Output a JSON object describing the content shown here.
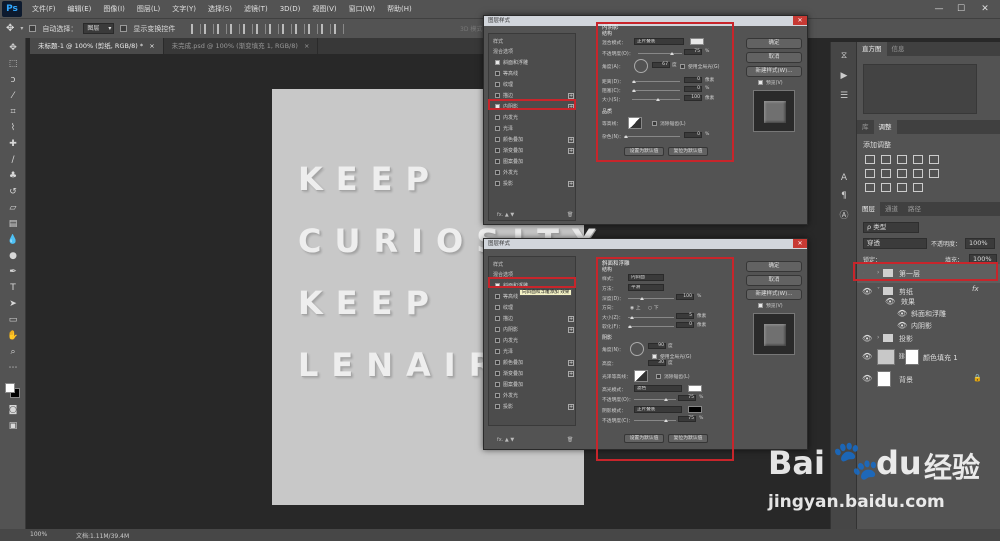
{
  "app": {
    "logo": "Ps"
  },
  "menubar": [
    "文件(F)",
    "编辑(E)",
    "图像(I)",
    "图层(L)",
    "文字(Y)",
    "选择(S)",
    "滤镜(T)",
    "3D(D)",
    "视图(V)",
    "窗口(W)",
    "帮助(H)"
  ],
  "window_controls": [
    "—",
    "☐",
    "✕"
  ],
  "options": {
    "auto_select_label": "自动选择：",
    "auto_select_value": "图层",
    "show_transform_label": "显示变换控件",
    "mode_3d_label": "3D 模式："
  },
  "doc_tabs": [
    {
      "label": "未标题-1 @ 100% (剪纸, RGB/8) *",
      "close": "×"
    },
    {
      "label": "未完成.psd @ 100% (渐变填充 1, RGB/8)",
      "close": "×"
    }
  ],
  "canvas": {
    "lines": [
      "KEEP",
      "CURIOSITY",
      "KEEP",
      "LENAIRNG"
    ],
    "bg": "#c8c8c8"
  },
  "status": {
    "zoom": "100%",
    "doc": "文档:1.11M/39.4M"
  },
  "panels": {
    "top_tabs": [
      "直方图",
      "信息"
    ],
    "adj_tabs": [
      "库",
      "调整"
    ],
    "adj_title": "添加调整",
    "layer_tabs": [
      "图层",
      "通道",
      "路径"
    ],
    "kind_label": "ρ 类型",
    "blend": "穿透",
    "opacity_label": "不透明度：",
    "opacity": "100%",
    "lock_label": "锁定：",
    "fill_label": "填充：",
    "fill": "100%",
    "layers": [
      {
        "name": "第一层",
        "type": "group",
        "fx": ""
      },
      {
        "name": "剪纸",
        "type": "group",
        "fx": "fx"
      },
      {
        "name": "效果",
        "type": "effect-head",
        "fx": ""
      },
      {
        "name": "斜面和浮雕",
        "type": "effect",
        "fx": ""
      },
      {
        "name": "内阴影",
        "type": "effect",
        "fx": ""
      },
      {
        "name": "投影",
        "type": "group",
        "fx": ""
      },
      {
        "name": "颜色填充 1",
        "type": "fill",
        "fx": ""
      },
      {
        "name": "背景",
        "type": "background",
        "fx": ""
      }
    ]
  },
  "dialog1": {
    "title": "图层样式",
    "list_header": "样式",
    "list_sub": "混合选项",
    "items": [
      {
        "label": "斜面和浮雕",
        "checked": true,
        "plus": false
      },
      {
        "label": "等高线",
        "checked": false,
        "plus": false
      },
      {
        "label": "纹理",
        "checked": false,
        "plus": false
      },
      {
        "label": "描边",
        "checked": false,
        "plus": true
      },
      {
        "label": "内阴影",
        "checked": true,
        "plus": true
      },
      {
        "label": "内发光",
        "checked": false,
        "plus": false
      },
      {
        "label": "光泽",
        "checked": false,
        "plus": false
      },
      {
        "label": "颜色叠加",
        "checked": false,
        "plus": true
      },
      {
        "label": "渐变叠加",
        "checked": false,
        "plus": true
      },
      {
        "label": "图案叠加",
        "checked": false,
        "plus": false
      },
      {
        "label": "外发光",
        "checked": false,
        "plus": false
      },
      {
        "label": "投影",
        "checked": false,
        "plus": true
      }
    ],
    "section_title": "内阴影",
    "struct_label": "结构",
    "blend_label": "混合模式：",
    "blend_value": "正片叠底",
    "opacity_label": "不透明度(O)：",
    "opacity_value": "75",
    "angle_label": "角度(A)：",
    "angle_value": "67",
    "global_light_label": "使用全局光(G)",
    "distance_label": "距离(D)：",
    "distance_value": "0",
    "choke_label": "阻塞(C)：",
    "choke_value": "0",
    "size_label": "大小(S)：",
    "size_value": "100",
    "quality_label": "品质",
    "contour_label": "等高线：",
    "antialias_label": "消除锯齿(L)",
    "noise_label": "杂色(N)：",
    "noise_value": "0",
    "btn_default": "设置为默认值",
    "btn_reset": "复位为默认值",
    "ok_label": "确定",
    "cancel_label": "取消",
    "new_style_label": "新建样式(W)...",
    "preview_label": "预览(V)"
  },
  "dialog2": {
    "title": "图层样式",
    "list_header": "样式",
    "list_sub": "混合选项",
    "tooltip": "向斜面和浮雕添加 效果",
    "items": [
      {
        "label": "斜面和浮雕",
        "checked": true,
        "plus": false
      },
      {
        "label": "等高线",
        "checked": false,
        "plus": false
      },
      {
        "label": "纹理",
        "checked": false,
        "plus": false
      },
      {
        "label": "描边",
        "checked": false,
        "plus": true
      },
      {
        "label": "内阴影",
        "checked": false,
        "plus": true
      },
      {
        "label": "内发光",
        "checked": false,
        "plus": false
      },
      {
        "label": "光泽",
        "checked": false,
        "plus": false
      },
      {
        "label": "颜色叠加",
        "checked": false,
        "plus": true
      },
      {
        "label": "渐变叠加",
        "checked": false,
        "plus": true
      },
      {
        "label": "图案叠加",
        "checked": false,
        "plus": false
      },
      {
        "label": "外发光",
        "checked": false,
        "plus": false
      },
      {
        "label": "投影",
        "checked": false,
        "plus": true
      }
    ],
    "section_title": "斜面和浮雕",
    "struct_label": "结构",
    "style_label": "样式：",
    "style_value": "内斜面",
    "method_label": "方法：",
    "method_value": "平滑",
    "depth_label": "深度(D)：",
    "depth_value": "100",
    "direction_label": "方向：",
    "dir_up": "上",
    "dir_down": "下",
    "size_label": "大小(Z)：",
    "size_value": "5",
    "soften_label": "软化(F)：",
    "soften_value": "0",
    "shading_label": "阴影",
    "angle_label": "角度(N)：",
    "angle_value": "90",
    "global_light_label": "使用全局光(G)",
    "altitude_label": "高度：",
    "altitude_value": "30",
    "gloss_label": "光泽等高线：",
    "antialias_label": "消除锯齿(L)",
    "highlight_label": "高光模式：",
    "highlight_value": "滤色",
    "hl_opacity_label": "不透明度(O)：",
    "hl_opacity_value": "75",
    "shadow_label": "阴影模式：",
    "shadow_value": "正片叠底",
    "sh_opacity_label": "不透明度(C)：",
    "sh_opacity_value": "75",
    "btn_default": "设置为默认值",
    "btn_reset": "复位为默认值",
    "ok_label": "确定",
    "cancel_label": "取消",
    "new_style_label": "新建样式(W)...",
    "preview_label": "预览(V)"
  },
  "units": {
    "percent": "%",
    "px": "像素",
    "deg": "度"
  },
  "watermark": {
    "brand_a": "Bai",
    "brand_b": "du",
    "brand_c": "经验",
    "url": "jingyan.baidu.com"
  },
  "colors": {
    "accent_red": "#c8252b",
    "panel": "#535353",
    "canvas_bg": "#282828",
    "highlight_chip": "#ffffff",
    "shadow_chip": "#000000"
  }
}
